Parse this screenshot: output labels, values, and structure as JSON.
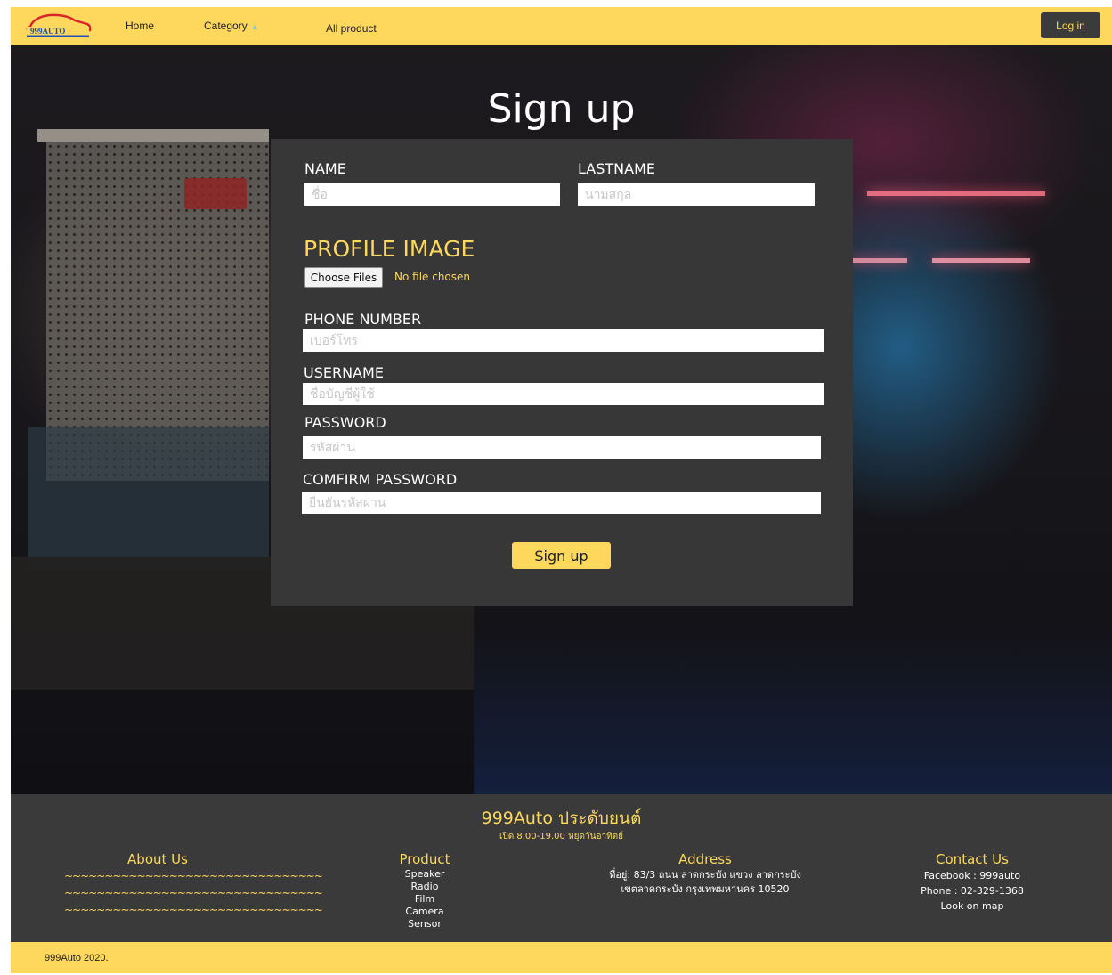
{
  "nav": {
    "logo_text": "999AUTO",
    "home": "Home",
    "category": "Category",
    "all_product": "All product",
    "login": "Log in"
  },
  "page": {
    "title": "Sign up"
  },
  "form": {
    "name_label": "NAME",
    "name_placeholder": "ชื่อ",
    "lastname_label": "LASTNAME",
    "lastname_placeholder": "นามสกุล",
    "profile_image_label": "PROFILE IMAGE",
    "choose_files": "Choose Files",
    "no_file": "No file chosen",
    "phone_label": "PHONE NUMBER",
    "phone_placeholder": "เบอร์โทร",
    "username_label": "USERNAME",
    "username_placeholder": "ชื่อบัญชีผู้ใช้",
    "password_label": "PASSWORD",
    "password_placeholder": "รหัสผ่าน",
    "confirm_label": "COMFIRM PASSWORD",
    "confirm_placeholder": "ยืนยันรหัสผ่าน",
    "submit": "Sign up"
  },
  "footer": {
    "brand": "999Auto ประดับยนต์",
    "hours": "เปิด 8.00-19.00 หยุดวันอาทิตย์",
    "about": {
      "title": "About Us",
      "lines": [
        "~~~~~~~~~~~~~~~~~~~~~~~~~~~~~~~~",
        "~~~~~~~~~~~~~~~~~~~~~~~~~~~~~~~~",
        "~~~~~~~~~~~~~~~~~~~~~~~~~~~~~~~~"
      ]
    },
    "product": {
      "title": "Product",
      "items": [
        "Speaker",
        "Radio",
        "Film",
        "Camera",
        "Sensor"
      ]
    },
    "address": {
      "title": "Address",
      "lines": [
        "ที่อยู่: 83/3 ถนน ลาดกระบัง แขวง ลาดกระบัง",
        "เขตลาดกระบัง กรุงเทพมหานคร 10520"
      ]
    },
    "contact": {
      "title": "Contact Us",
      "facebook": "Facebook : 999auto",
      "phone": "Phone : 02-329-1368",
      "map": "Look on map"
    },
    "copyright": "999Auto 2020."
  },
  "colors": {
    "accent_yellow": "#fdd85d",
    "panel_dark": "#373737",
    "footer_dark": "#3a3a3a"
  }
}
